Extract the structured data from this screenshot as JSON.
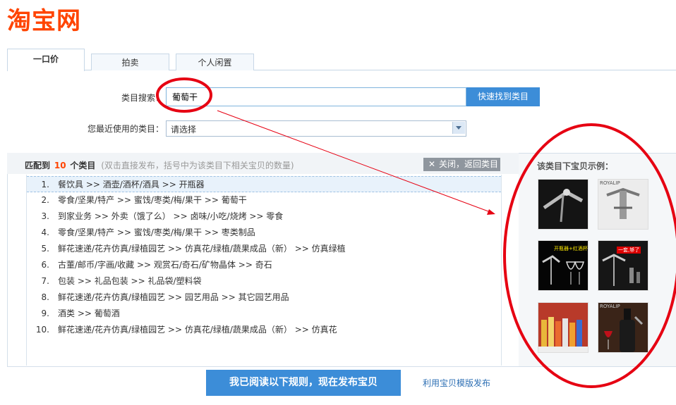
{
  "logo": {
    "text": "淘宝网"
  },
  "tabs": [
    {
      "label": "一口价",
      "active": true
    },
    {
      "label": "拍卖",
      "active": false
    },
    {
      "label": "个人闲置",
      "active": false
    }
  ],
  "search": {
    "label": "类目搜索：",
    "value": "葡萄干",
    "button": "快速找到类目"
  },
  "recent": {
    "label": "您最近使用的类目：",
    "selected": "请选择"
  },
  "results": {
    "prefix": "匹配到",
    "count": "10",
    "suffix": "个类目",
    "hint": "(双击直接发布，括号中为该类目下相关宝贝的数量)",
    "close_label": "关闭，返回类目",
    "items": [
      {
        "num": "1.",
        "path": "餐饮具 >> 酒壶/酒杯/酒具 >> 开瓶器"
      },
      {
        "num": "2.",
        "path": "零食/坚果/特产 >> 蜜饯/枣类/梅/果干 >> 葡萄干"
      },
      {
        "num": "3.",
        "path": "到家业务 >> 外卖（饿了么） >> 卤味/小吃/烧烤 >> 零食"
      },
      {
        "num": "4.",
        "path": "零食/坚果/特产 >> 蜜饯/枣类/梅/果干 >> 枣类制品"
      },
      {
        "num": "5.",
        "path": "鲜花速递/花卉仿真/绿植园艺 >> 仿真花/绿植/蔬果成品（新） >> 仿真绿植"
      },
      {
        "num": "6.",
        "path": "古董/邮币/字画/收藏 >> 观赏石/奇石/矿物晶体 >> 奇石"
      },
      {
        "num": "7.",
        "path": "包装 >> 礼品包装 >> 礼品袋/塑料袋"
      },
      {
        "num": "8.",
        "path": "鲜花速递/花卉仿真/绿植园艺 >> 园艺用品 >> 其它园艺用品"
      },
      {
        "num": "9.",
        "path": "酒类 >> 葡萄酒"
      },
      {
        "num": "10.",
        "path": "鲜花速递/花卉仿真/绿植园艺 >> 仿真花/绿植/蔬果成品（新） >> 仿真花"
      }
    ]
  },
  "examples": {
    "title": "该类目下宝贝示例：",
    "thumb_texts": [
      "ROYALIP",
      "开瓶器+红酒杯",
      "一套,够了",
      "ROYALIP"
    ]
  },
  "footer": {
    "publish": "我已阅读以下规则，现在发布宝贝",
    "template_link": "利用宝贝模版发布"
  },
  "colors": {
    "brand": "#ff4400",
    "accent": "#3c8dd8",
    "annotation": "#e60012"
  }
}
